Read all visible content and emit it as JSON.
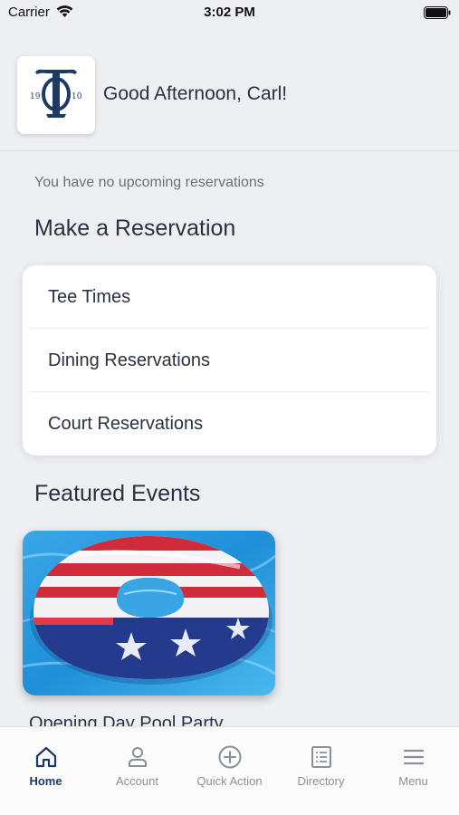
{
  "status_bar": {
    "carrier": "Carrier",
    "time": "3:02 PM"
  },
  "header": {
    "logo_year_left": "19",
    "logo_year_right": "10",
    "greeting": "Good Afternoon, Carl!"
  },
  "reservations": {
    "empty_message": "You have no upcoming reservations",
    "title": "Make a Reservation",
    "items": [
      {
        "label": "Tee Times"
      },
      {
        "label": "Dining Reservations"
      },
      {
        "label": "Court Reservations"
      }
    ]
  },
  "featured": {
    "title": "Featured Events",
    "events": [
      {
        "title": "Opening Day Pool Party",
        "image": "inflatable-pool-ring-image"
      }
    ]
  },
  "tab_bar": {
    "active": "Home",
    "tabs": [
      {
        "label": "Home",
        "icon": "home-icon"
      },
      {
        "label": "Account",
        "icon": "account-icon"
      },
      {
        "label": "Quick Action",
        "icon": "plus-circle-icon"
      },
      {
        "label": "Directory",
        "icon": "directory-icon"
      },
      {
        "label": "Menu",
        "icon": "hamburger-icon"
      }
    ]
  },
  "colors": {
    "background": "#eeeff3",
    "text": "#2a3240",
    "brand_navy": "#1d3a63",
    "tab_inactive": "#8a8f98"
  }
}
